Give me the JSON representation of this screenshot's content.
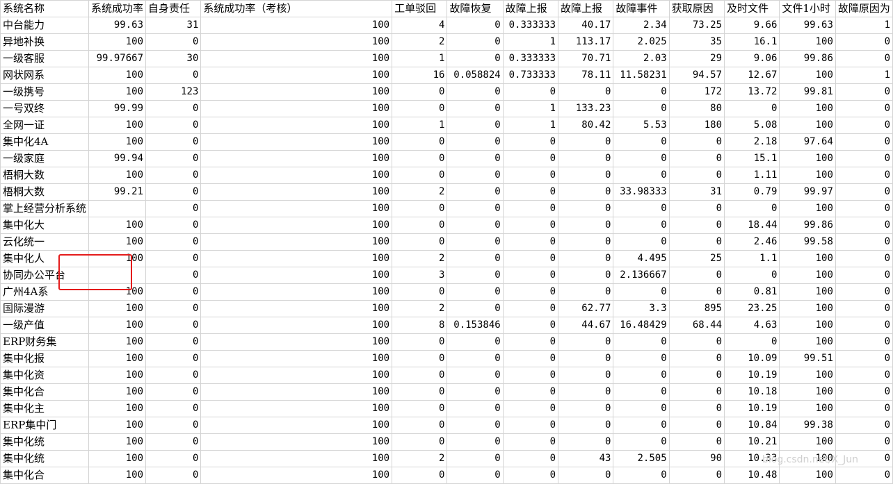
{
  "sheet": {
    "headers": [
      "系统名称",
      "系统成功率",
      "自身责任",
      "系统成功率（考核）",
      "工单驳回",
      "故障恢复",
      "故障上报",
      "故障上报",
      "故障事件",
      "获取原因",
      "及时文件",
      "文件1小时",
      "故障原因为"
    ],
    "rows": [
      [
        "中台能力",
        "99.63",
        "31",
        "100",
        "4",
        "0",
        "0.333333",
        "40.17",
        "2.34",
        "73.25",
        "9.66",
        "99.63",
        "1"
      ],
      [
        "异地补换",
        "100",
        "0",
        "100",
        "2",
        "0",
        "1",
        "113.17",
        "2.025",
        "35",
        "16.1",
        "100",
        "0"
      ],
      [
        "一级客服",
        "99.97667",
        "30",
        "100",
        "1",
        "0",
        "0.333333",
        "70.71",
        "2.03",
        "29",
        "9.06",
        "99.86",
        "0"
      ],
      [
        "网状网系",
        "100",
        "0",
        "100",
        "16",
        "0.058824",
        "0.733333",
        "78.11",
        "11.58231",
        "94.57",
        "12.67",
        "100",
        "1"
      ],
      [
        "一级携号",
        "100",
        "123",
        "100",
        "0",
        "0",
        "0",
        "0",
        "0",
        "172",
        "13.72",
        "99.81",
        "0"
      ],
      [
        "一号双终",
        "99.99",
        "0",
        "100",
        "0",
        "0",
        "1",
        "133.23",
        "0",
        "80",
        "0",
        "100",
        "0"
      ],
      [
        "全网一证",
        "100",
        "0",
        "100",
        "1",
        "0",
        "1",
        "80.42",
        "5.53",
        "180",
        "5.08",
        "100",
        "0"
      ],
      [
        "集中化4A",
        "100",
        "0",
        "100",
        "0",
        "0",
        "0",
        "0",
        "0",
        "0",
        "2.18",
        "97.64",
        "0"
      ],
      [
        "一级家庭",
        "99.94",
        "0",
        "100",
        "0",
        "0",
        "0",
        "0",
        "0",
        "0",
        "15.1",
        "100",
        "0"
      ],
      [
        "梧桐大数",
        "100",
        "0",
        "100",
        "0",
        "0",
        "0",
        "0",
        "0",
        "0",
        "1.11",
        "100",
        "0"
      ],
      [
        "梧桐大数",
        "99.21",
        "0",
        "100",
        "2",
        "0",
        "0",
        "0",
        "33.98333",
        "31",
        "0.79",
        "99.97",
        "0"
      ],
      [
        "掌上经营分析系统",
        "",
        "0",
        "100",
        "0",
        "0",
        "0",
        "0",
        "0",
        "0",
        "0",
        "100",
        "0"
      ],
      [
        "集中化大",
        "100",
        "0",
        "100",
        "0",
        "0",
        "0",
        "0",
        "0",
        "0",
        "18.44",
        "99.86",
        "0"
      ],
      [
        "云化统一",
        "100",
        "0",
        "100",
        "0",
        "0",
        "0",
        "0",
        "0",
        "0",
        "2.46",
        "99.58",
        "0"
      ],
      [
        "集中化人",
        "100",
        "0",
        "100",
        "2",
        "0",
        "0",
        "0",
        "4.495",
        "25",
        "1.1",
        "100",
        "0"
      ],
      [
        "协同办公平台",
        "",
        "0",
        "100",
        "3",
        "0",
        "0",
        "0",
        "2.136667",
        "0",
        "0",
        "100",
        "0"
      ],
      [
        "广州4A系",
        "100",
        "0",
        "100",
        "0",
        "0",
        "0",
        "0",
        "0",
        "0",
        "0.81",
        "100",
        "0"
      ],
      [
        "国际漫游",
        "100",
        "0",
        "100",
        "2",
        "0",
        "0",
        "62.77",
        "3.3",
        "895",
        "23.25",
        "100",
        "0"
      ],
      [
        "一级产值",
        "100",
        "0",
        "100",
        "8",
        "0.153846",
        "0",
        "44.67",
        "16.48429",
        "68.44",
        "4.63",
        "100",
        "0"
      ],
      [
        "ERP财务集",
        "100",
        "0",
        "100",
        "0",
        "0",
        "0",
        "0",
        "0",
        "0",
        "0",
        "100",
        "0"
      ],
      [
        "集中化报",
        "100",
        "0",
        "100",
        "0",
        "0",
        "0",
        "0",
        "0",
        "0",
        "10.09",
        "99.51",
        "0"
      ],
      [
        "集中化资",
        "100",
        "0",
        "100",
        "0",
        "0",
        "0",
        "0",
        "0",
        "0",
        "10.19",
        "100",
        "0"
      ],
      [
        "集中化合",
        "100",
        "0",
        "100",
        "0",
        "0",
        "0",
        "0",
        "0",
        "0",
        "10.18",
        "100",
        "0"
      ],
      [
        "集中化主",
        "100",
        "0",
        "100",
        "0",
        "0",
        "0",
        "0",
        "0",
        "0",
        "10.19",
        "100",
        "0"
      ],
      [
        "ERP集中门",
        "100",
        "0",
        "100",
        "0",
        "0",
        "0",
        "0",
        "0",
        "0",
        "10.84",
        "99.38",
        "0"
      ],
      [
        "集中化统",
        "100",
        "0",
        "100",
        "0",
        "0",
        "0",
        "0",
        "0",
        "0",
        "10.21",
        "100",
        "0"
      ],
      [
        "集中化统",
        "100",
        "0",
        "100",
        "2",
        "0",
        "0",
        "43",
        "2.505",
        "90",
        "10.33",
        "100",
        "0"
      ],
      [
        "集中化合",
        "100",
        "0",
        "100",
        "0",
        "0",
        "0",
        "0",
        "0",
        "0",
        "10.48",
        "100",
        "0"
      ]
    ]
  },
  "watermark": "blog.csdn.net/X_Jun",
  "highlight_color": "#e41b1b"
}
